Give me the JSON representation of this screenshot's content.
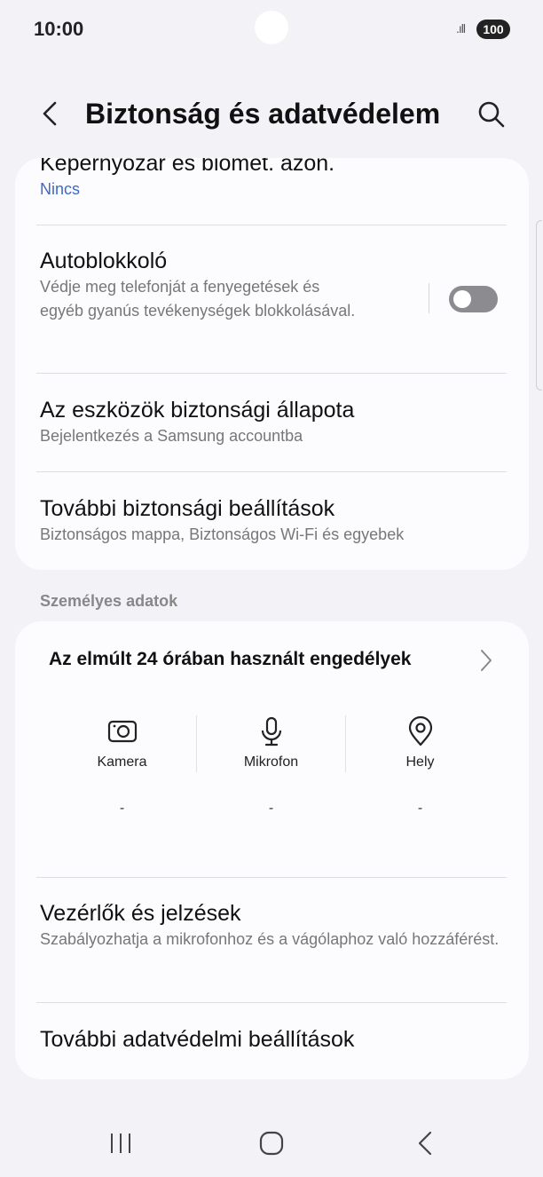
{
  "status_bar": {
    "time": "10:00",
    "signal_icon": "signal-bars-icon",
    "battery": "100"
  },
  "app_bar": {
    "title": "Biztonság és adatvédelem",
    "back_icon": "chevron-left-icon",
    "search_icon": "search-icon"
  },
  "security_card": {
    "screen_lock": {
      "title": "Képernyőzár és biomet. azon.",
      "value": "Nincs"
    },
    "auto_blocker": {
      "title": "Autoblokkoló",
      "description": "Védje meg telefonját a fenyegetések és egyéb gyanús tevékenységek blokkolásával.",
      "toggle_state": "off"
    },
    "device_security": {
      "title": "Az eszközök biztonsági állapota",
      "subtitle": "Bejelentkezés a Samsung accountba"
    },
    "more_security": {
      "title": "További biztonsági beállítások",
      "subtitle": "Biztonságos mappa, Biztonságos Wi-Fi és egyebek"
    }
  },
  "personal_section": {
    "header": "Személyes adatok",
    "permissions": {
      "title": "Az elmúlt 24 órában használt engedélyek",
      "items": [
        {
          "label": "Kamera",
          "value": "-",
          "icon": "camera-icon"
        },
        {
          "label": "Mikrofon",
          "value": "-",
          "icon": "microphone-icon"
        },
        {
          "label": "Hely",
          "value": "-",
          "icon": "location-pin-icon"
        }
      ]
    },
    "controls": {
      "title": "Vezérlők és jelzések",
      "subtitle": "Szabályozhatja a mikrofonhoz és a vágólaphoz való hozzáférést."
    },
    "more_privacy": {
      "title": "További adatvédelmi beállítások"
    }
  },
  "colors": {
    "background": "#f3f2f7",
    "card": "#fcfcff",
    "accent_link": "#3e68c9",
    "toggle_off": "#8b8b90"
  }
}
